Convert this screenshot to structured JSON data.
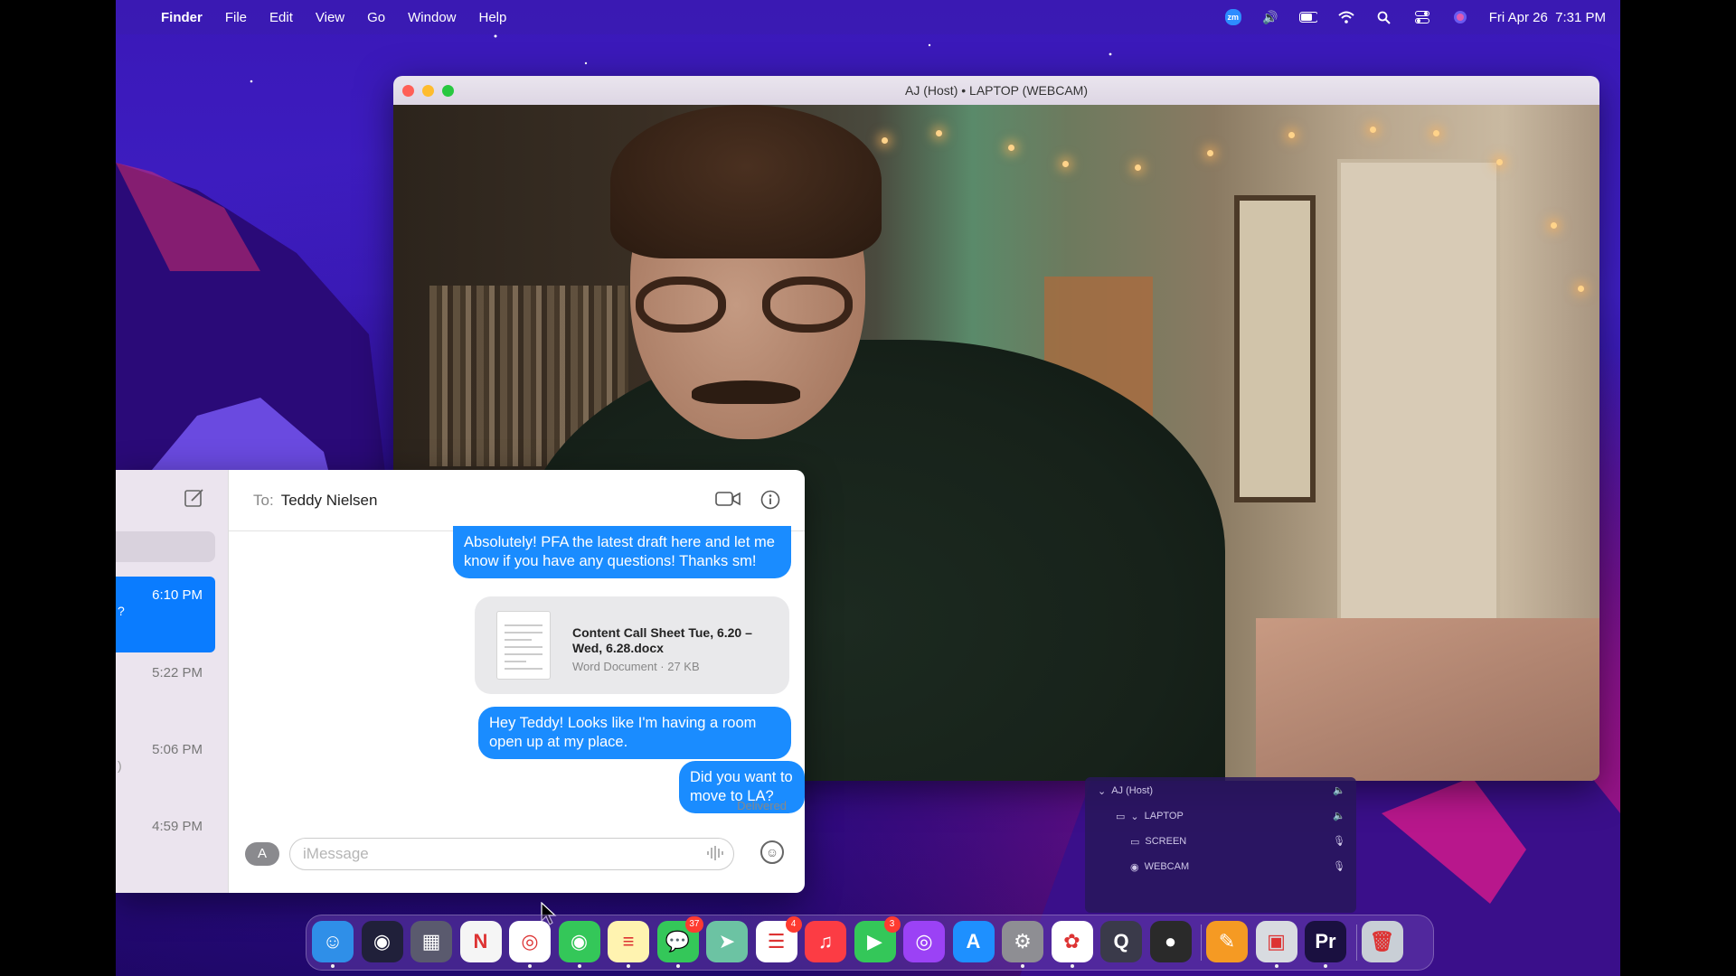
{
  "menubar": {
    "app_name": "Finder",
    "items": [
      "File",
      "Edit",
      "View",
      "Go",
      "Window",
      "Help"
    ],
    "clock": "Fri Apr 26  7:31 PM",
    "zoom_badge": "zm"
  },
  "webcam_window": {
    "title": "AJ (Host) • LAPTOP (WEBCAM)"
  },
  "audio_panel": {
    "rows": [
      "AJ (Host)",
      "LAPTOP",
      "SCREEN",
      "WEBCAM"
    ]
  },
  "messages": {
    "to_label": "To:",
    "recipient": "Teddy Nielsen",
    "conversations": [
      {
        "time": "6:10 PM",
        "snippet": "?"
      },
      {
        "time": "5:22 PM",
        "snippet": ""
      },
      {
        "time": "5:06 PM",
        "snippet": ")"
      },
      {
        "time": "4:59 PM",
        "snippet": ""
      }
    ],
    "bubbles": [
      "Absolutely! PFA the latest draft here and let me know if you have any questions! Thanks sm!",
      "Hey Teddy! Looks like I'm having a room open up at my place.",
      "Did you want to move to LA?"
    ],
    "attachment": {
      "filename": "Content Call Sheet Tue, 6.20 – Wed, 6.28.docx",
      "meta": "Word Document · 27 KB"
    },
    "status": "Delivered",
    "input_placeholder": "iMessage"
  },
  "dock": {
    "items": [
      {
        "name": "Finder",
        "icon": "finder-icon",
        "color": "#2f8fe8"
      },
      {
        "name": "Siri",
        "icon": "siri-icon",
        "color": "#20203a"
      },
      {
        "name": "Launchpad",
        "icon": "launchpad-icon",
        "color": "#5a5a6e"
      },
      {
        "name": "News",
        "icon": "news-icon",
        "color": "#f5f5f5"
      },
      {
        "name": "Chrome",
        "icon": "chrome-icon",
        "color": "#ffffff"
      },
      {
        "name": "Find My",
        "icon": "findmy-icon",
        "color": "#34c759"
      },
      {
        "name": "Notes",
        "icon": "notes-icon",
        "color": "#fff3b0"
      },
      {
        "name": "Messages",
        "icon": "messages-icon",
        "color": "#34c759",
        "badge": "37"
      },
      {
        "name": "Maps",
        "icon": "maps-icon",
        "color": "#6cc3a3"
      },
      {
        "name": "Reminders",
        "icon": "reminders-icon",
        "color": "#ffffff",
        "badge": "4"
      },
      {
        "name": "Music",
        "icon": "music-icon",
        "color": "#fc3c44"
      },
      {
        "name": "FaceTime",
        "icon": "facetime-icon",
        "color": "#34c759",
        "badge": "3"
      },
      {
        "name": "Podcasts",
        "icon": "podcasts-icon",
        "color": "#9b42f5"
      },
      {
        "name": "App Store",
        "icon": "appstore-icon",
        "color": "#1e90ff"
      },
      {
        "name": "System Settings",
        "icon": "settings-icon",
        "color": "#8e8e93"
      },
      {
        "name": "Photos",
        "icon": "photos-icon",
        "color": "#ffffff"
      },
      {
        "name": "QuickTime",
        "icon": "quicktime-icon",
        "color": "#3a3a4a"
      },
      {
        "name": "Photo Booth",
        "icon": "photobooth-icon",
        "color": "#2a2a2a"
      },
      {
        "name": "Pages",
        "icon": "pages-icon",
        "color": "#f59a23"
      },
      {
        "name": "Preview",
        "icon": "preview-icon",
        "color": "#d8dbe0"
      },
      {
        "name": "Premiere Pro",
        "icon": "premiere-icon",
        "color": "#1a1040",
        "label": "Pr"
      },
      {
        "name": "Trash",
        "icon": "trash-icon",
        "color": "#c9cfd6"
      }
    ]
  }
}
